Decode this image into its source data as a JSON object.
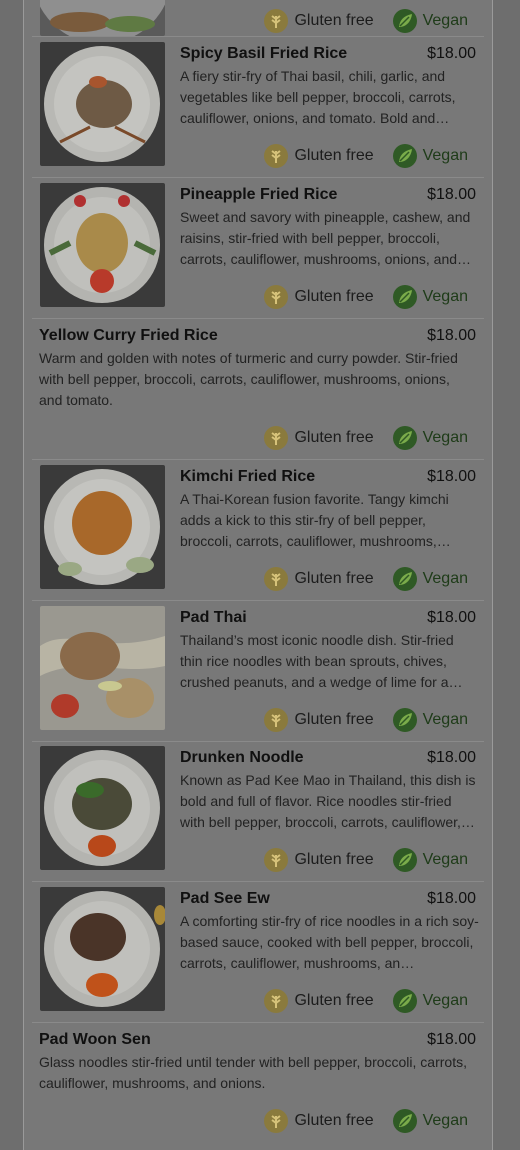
{
  "menu": {
    "badge_gluten_free": "Gluten free",
    "badge_vegan": "Vegan",
    "items": [
      {
        "name": "Spicy Basil Fried Rice",
        "price": "$18.00",
        "description": "A fiery stir-fry of Thai basil, chili, garlic, and vegetables like bell pepper, broccoli, carrots, cauliflower, onions, and tomato. Bold and…"
      },
      {
        "name": "Pineapple Fried Rice",
        "price": "$18.00",
        "description": "Sweet and savory with pineapple, cashew, and raisins, stir-fried with bell pepper, broccoli, carrots, cauliflower, mushrooms, onions, and…"
      },
      {
        "name": "Yellow Curry Fried Rice",
        "price": "$18.00",
        "description": "Warm and golden with notes of turmeric and curry powder. Stir-fried with bell pepper, broccoli, carrots, cauliflower, mushrooms, onions, and tomato."
      },
      {
        "name": "Kimchi Fried Rice",
        "price": "$18.00",
        "description": "A Thai-Korean fusion favorite. Tangy kimchi adds a kick to this stir-fry of bell pepper, broccoli, carrots, cauliflower, mushrooms,…"
      },
      {
        "name": "Pad Thai",
        "price": "$18.00",
        "description": "Thailand’s most iconic noodle dish. Stir-fried thin rice noodles with bean sprouts, chives, crushed peanuts, and a wedge of lime for a…"
      },
      {
        "name": "Drunken Noodle",
        "price": "$18.00",
        "description": "Known as Pad Kee Mao in Thailand, this dish is bold and full of flavor. Rice noodles stir-fried with bell pepper, broccoli, carrots, cauliflower,…"
      },
      {
        "name": "Pad See Ew",
        "price": "$18.00",
        "description": "A comforting stir-fry of rice noodles in a rich soy-based sauce, cooked with bell pepper, broccoli, carrots, cauliflower, mushrooms, an…"
      },
      {
        "name": "Pad Woon Sen",
        "price": "$18.00",
        "description": "Glass noodles stir-fried until tender with bell pepper, broccoli, carrots, cauliflower, mushrooms, and onions."
      }
    ]
  }
}
